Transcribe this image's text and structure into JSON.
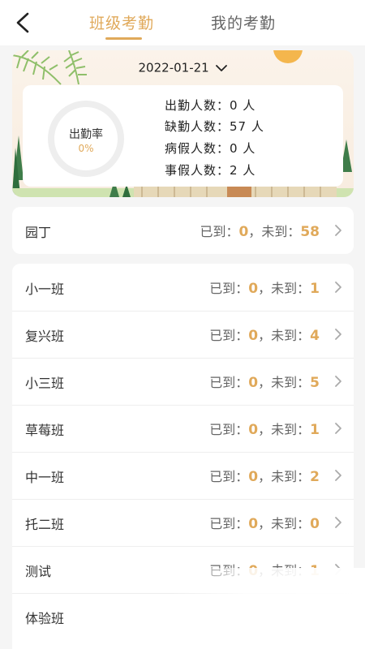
{
  "header": {
    "tabs": [
      {
        "label": "班级考勤",
        "active": true
      },
      {
        "label": "我的考勤",
        "active": false
      }
    ]
  },
  "summary": {
    "date": "2022-01-21",
    "rate_label": "出勤率",
    "rate_value": "0%",
    "rate_fraction": 0,
    "stats": [
      "出勤人数：0 人",
      "缺勤人数：57 人",
      "病假人数：0 人",
      "事假人数：2 人"
    ]
  },
  "gardener": {
    "name": "园丁",
    "arrived_label": "已到：",
    "arrived": "0",
    "sep": "，",
    "absent_label": "未到：",
    "absent": "58"
  },
  "classes": [
    {
      "name": "小一班",
      "arrived_label": "已到：",
      "arrived": "0",
      "sep": "，",
      "absent_label": "未到：",
      "absent": "1"
    },
    {
      "name": "复兴班",
      "arrived_label": "已到：",
      "arrived": "0",
      "sep": "，",
      "absent_label": "未到：",
      "absent": "4"
    },
    {
      "name": "小三班",
      "arrived_label": "已到：",
      "arrived": "0",
      "sep": "，",
      "absent_label": "未到：",
      "absent": "5"
    },
    {
      "name": "草莓班",
      "arrived_label": "已到：",
      "arrived": "0",
      "sep": "，",
      "absent_label": "未到：",
      "absent": "1"
    },
    {
      "name": "中一班",
      "arrived_label": "已到：",
      "arrived": "0",
      "sep": "，",
      "absent_label": "未到：",
      "absent": "2"
    },
    {
      "name": "托二班",
      "arrived_label": "已到：",
      "arrived": "0",
      "sep": "，",
      "absent_label": "未到：",
      "absent": "0"
    },
    {
      "name": "测试",
      "arrived_label": "已到：",
      "arrived": "0",
      "sep": "，",
      "absent_label": "未到：",
      "absent": "1"
    },
    {
      "name": "体验班",
      "arrived_label": "",
      "arrived": "",
      "sep": "",
      "absent_label": "",
      "absent": ""
    }
  ],
  "colors": {
    "accent": "#e0a95a",
    "sun": "#f4b64d"
  }
}
